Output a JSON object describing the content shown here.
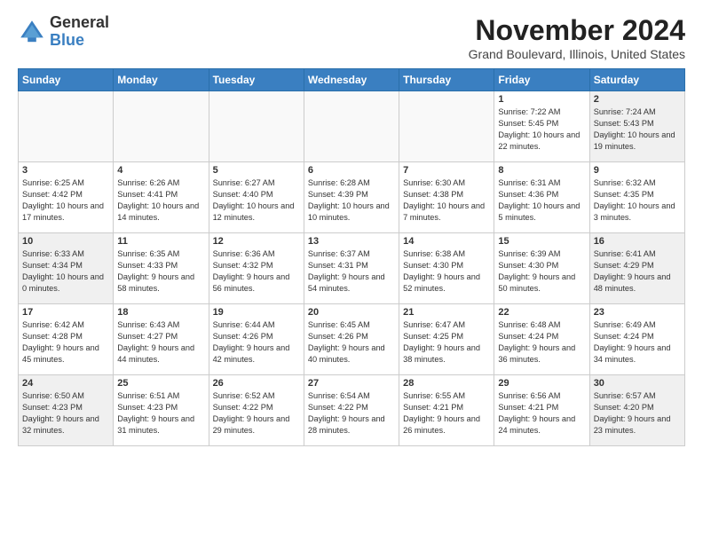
{
  "header": {
    "logo_general": "General",
    "logo_blue": "Blue",
    "month_title": "November 2024",
    "location": "Grand Boulevard, Illinois, United States"
  },
  "days_of_week": [
    "Sunday",
    "Monday",
    "Tuesday",
    "Wednesday",
    "Thursday",
    "Friday",
    "Saturday"
  ],
  "weeks": [
    [
      {
        "day": "",
        "info": ""
      },
      {
        "day": "",
        "info": ""
      },
      {
        "day": "",
        "info": ""
      },
      {
        "day": "",
        "info": ""
      },
      {
        "day": "",
        "info": ""
      },
      {
        "day": "1",
        "info": "Sunrise: 7:22 AM\nSunset: 5:45 PM\nDaylight: 10 hours and 22 minutes."
      },
      {
        "day": "2",
        "info": "Sunrise: 7:24 AM\nSunset: 5:43 PM\nDaylight: 10 hours and 19 minutes."
      }
    ],
    [
      {
        "day": "3",
        "info": "Sunrise: 6:25 AM\nSunset: 4:42 PM\nDaylight: 10 hours and 17 minutes."
      },
      {
        "day": "4",
        "info": "Sunrise: 6:26 AM\nSunset: 4:41 PM\nDaylight: 10 hours and 14 minutes."
      },
      {
        "day": "5",
        "info": "Sunrise: 6:27 AM\nSunset: 4:40 PM\nDaylight: 10 hours and 12 minutes."
      },
      {
        "day": "6",
        "info": "Sunrise: 6:28 AM\nSunset: 4:39 PM\nDaylight: 10 hours and 10 minutes."
      },
      {
        "day": "7",
        "info": "Sunrise: 6:30 AM\nSunset: 4:38 PM\nDaylight: 10 hours and 7 minutes."
      },
      {
        "day": "8",
        "info": "Sunrise: 6:31 AM\nSunset: 4:36 PM\nDaylight: 10 hours and 5 minutes."
      },
      {
        "day": "9",
        "info": "Sunrise: 6:32 AM\nSunset: 4:35 PM\nDaylight: 10 hours and 3 minutes."
      }
    ],
    [
      {
        "day": "10",
        "info": "Sunrise: 6:33 AM\nSunset: 4:34 PM\nDaylight: 10 hours and 0 minutes."
      },
      {
        "day": "11",
        "info": "Sunrise: 6:35 AM\nSunset: 4:33 PM\nDaylight: 9 hours and 58 minutes."
      },
      {
        "day": "12",
        "info": "Sunrise: 6:36 AM\nSunset: 4:32 PM\nDaylight: 9 hours and 56 minutes."
      },
      {
        "day": "13",
        "info": "Sunrise: 6:37 AM\nSunset: 4:31 PM\nDaylight: 9 hours and 54 minutes."
      },
      {
        "day": "14",
        "info": "Sunrise: 6:38 AM\nSunset: 4:30 PM\nDaylight: 9 hours and 52 minutes."
      },
      {
        "day": "15",
        "info": "Sunrise: 6:39 AM\nSunset: 4:30 PM\nDaylight: 9 hours and 50 minutes."
      },
      {
        "day": "16",
        "info": "Sunrise: 6:41 AM\nSunset: 4:29 PM\nDaylight: 9 hours and 48 minutes."
      }
    ],
    [
      {
        "day": "17",
        "info": "Sunrise: 6:42 AM\nSunset: 4:28 PM\nDaylight: 9 hours and 45 minutes."
      },
      {
        "day": "18",
        "info": "Sunrise: 6:43 AM\nSunset: 4:27 PM\nDaylight: 9 hours and 44 minutes."
      },
      {
        "day": "19",
        "info": "Sunrise: 6:44 AM\nSunset: 4:26 PM\nDaylight: 9 hours and 42 minutes."
      },
      {
        "day": "20",
        "info": "Sunrise: 6:45 AM\nSunset: 4:26 PM\nDaylight: 9 hours and 40 minutes."
      },
      {
        "day": "21",
        "info": "Sunrise: 6:47 AM\nSunset: 4:25 PM\nDaylight: 9 hours and 38 minutes."
      },
      {
        "day": "22",
        "info": "Sunrise: 6:48 AM\nSunset: 4:24 PM\nDaylight: 9 hours and 36 minutes."
      },
      {
        "day": "23",
        "info": "Sunrise: 6:49 AM\nSunset: 4:24 PM\nDaylight: 9 hours and 34 minutes."
      }
    ],
    [
      {
        "day": "24",
        "info": "Sunrise: 6:50 AM\nSunset: 4:23 PM\nDaylight: 9 hours and 32 minutes."
      },
      {
        "day": "25",
        "info": "Sunrise: 6:51 AM\nSunset: 4:23 PM\nDaylight: 9 hours and 31 minutes."
      },
      {
        "day": "26",
        "info": "Sunrise: 6:52 AM\nSunset: 4:22 PM\nDaylight: 9 hours and 29 minutes."
      },
      {
        "day": "27",
        "info": "Sunrise: 6:54 AM\nSunset: 4:22 PM\nDaylight: 9 hours and 28 minutes."
      },
      {
        "day": "28",
        "info": "Sunrise: 6:55 AM\nSunset: 4:21 PM\nDaylight: 9 hours and 26 minutes."
      },
      {
        "day": "29",
        "info": "Sunrise: 6:56 AM\nSunset: 4:21 PM\nDaylight: 9 hours and 24 minutes."
      },
      {
        "day": "30",
        "info": "Sunrise: 6:57 AM\nSunset: 4:20 PM\nDaylight: 9 hours and 23 minutes."
      }
    ]
  ]
}
